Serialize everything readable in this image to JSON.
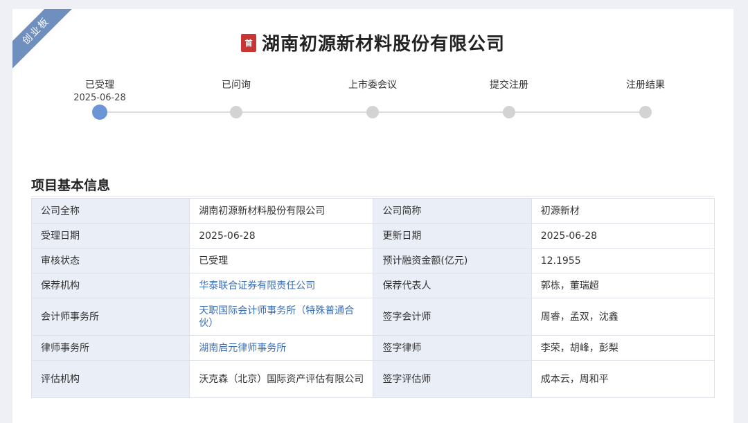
{
  "ribbon": "创业板",
  "header": {
    "icon_text": "首",
    "company_name": "湖南初源新材料股份有限公司"
  },
  "progress": {
    "steps": [
      {
        "label": "已受理",
        "date": "2025-06-28",
        "active": true
      },
      {
        "label": "已问询",
        "date": "",
        "active": false
      },
      {
        "label": "上市委会议",
        "date": "",
        "active": false
      },
      {
        "label": "提交注册",
        "date": "",
        "active": false
      },
      {
        "label": "注册结果",
        "date": "",
        "active": false
      }
    ]
  },
  "section": {
    "title": "项目基本信息"
  },
  "info_rows": [
    {
      "k1": "公司全称",
      "v1": "湖南初源新材料股份有限公司",
      "k2": "公司简称",
      "v2": "初源新材"
    },
    {
      "k1": "受理日期",
      "v1": "2025-06-28",
      "k2": "更新日期",
      "v2": "2025-06-28"
    },
    {
      "k1": "审核状态",
      "v1": "已受理",
      "k2": "预计融资金额(亿元)",
      "v2": "12.1955"
    },
    {
      "k1": "保荐机构",
      "v1": "华泰联合证券有限责任公司",
      "k2": "保荐代表人",
      "v2": "郭栋，董瑞超"
    },
    {
      "k1": "会计师事务所",
      "v1": "天职国际会计师事务所（特殊普通合伙）",
      "k2": "签字会计师",
      "v2": "周睿，孟双，沈鑫"
    },
    {
      "k1": "律师事务所",
      "v1": "湖南启元律师事务所",
      "k2": "签字律师",
      "v2": "李荣，胡峰，彭梨"
    },
    {
      "k1": "评估机构",
      "v1": "沃克森（北京）国际资产评估有限公司",
      "k2": "签字评估师",
      "v2": "成本云，周和平"
    }
  ],
  "colors": {
    "accent": "#6d94d6",
    "link": "#3b6fb6",
    "key_bg": "#e9eef7",
    "ribbon": "#6f8fbf",
    "title_icon": "#c93434"
  }
}
